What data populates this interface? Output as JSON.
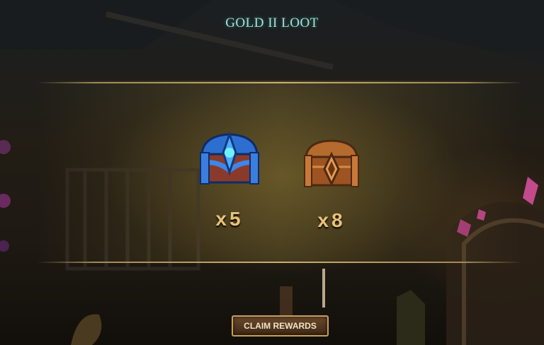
{
  "screen": {
    "title": "GOLD II LOOT"
  },
  "rewards": [
    {
      "icon": "epic-blue-chest-icon",
      "quantity": "x5"
    },
    {
      "icon": "bronze-chest-icon",
      "quantity": "x8"
    }
  ],
  "actions": {
    "claim_label": "CLAIM REWARDS"
  },
  "colors": {
    "title": "#9fe3dc",
    "quantity": "#e9c27a",
    "button_border": "#c79f5b"
  }
}
